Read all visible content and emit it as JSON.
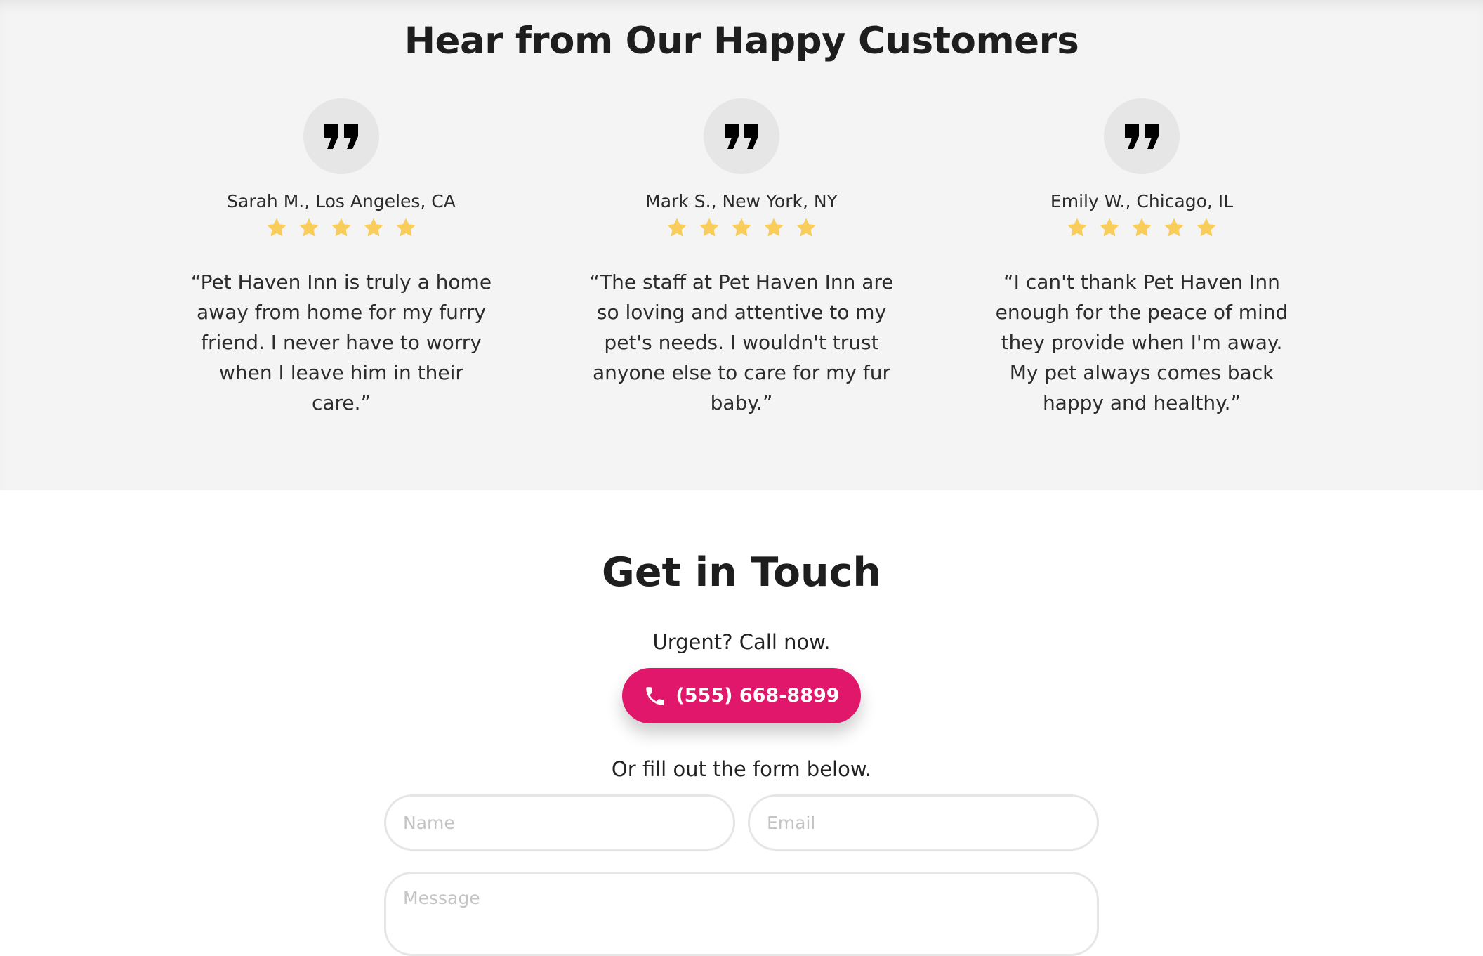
{
  "testimonials": {
    "title": "Hear from Our Happy Customers",
    "star_color": "#f9cd5b",
    "items": [
      {
        "author": "Sarah M., Los Angeles, CA",
        "rating": 5,
        "quote": "“Pet Haven Inn is truly a home away from home for my furry friend. I never have to worry when I leave him in their care.”"
      },
      {
        "author": "Mark S., New York, NY",
        "rating": 5,
        "quote": "“The staff at Pet Haven Inn are so loving and attentive to my pet's needs. I wouldn't trust anyone else to care for my fur baby.”"
      },
      {
        "author": "Emily W., Chicago, IL",
        "rating": 5,
        "quote": "“I can't thank Pet Haven Inn enough for the peace of mind they provide when I'm away. My pet always comes back happy and healthy.”"
      }
    ]
  },
  "contact": {
    "title": "Get in Touch",
    "urgent_text": "Urgent? Call now.",
    "phone_label": "(555) 668-8899",
    "button_color": "#e0176a",
    "form_intro": "Or fill out the form below.",
    "name_placeholder": "Name",
    "email_placeholder": "Email",
    "message_placeholder": "Message"
  }
}
